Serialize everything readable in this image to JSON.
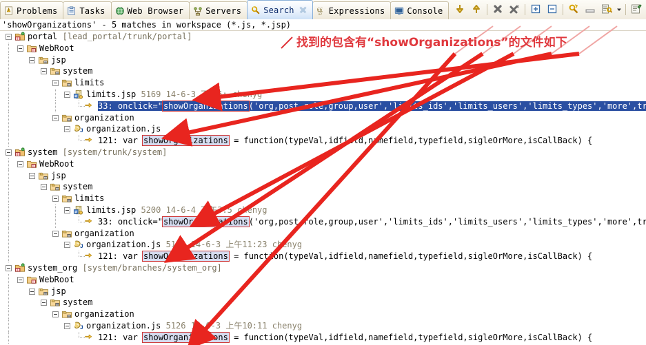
{
  "window": {
    "tabs": [
      {
        "label": "Problems",
        "icon": "problems-icon",
        "active": false,
        "closable": false
      },
      {
        "label": "Tasks",
        "icon": "tasks-icon",
        "active": false,
        "closable": false
      },
      {
        "label": "Web Browser",
        "icon": "web-browser-icon",
        "active": false,
        "closable": false
      },
      {
        "label": "Servers",
        "icon": "servers-icon",
        "active": false,
        "closable": false
      },
      {
        "label": "Search",
        "icon": "search-icon",
        "active": true,
        "closable": true
      },
      {
        "label": "Expressions",
        "icon": "expressions-icon",
        "active": false,
        "closable": false
      },
      {
        "label": "Console",
        "icon": "console-icon",
        "active": false,
        "closable": false
      }
    ],
    "toolbar": [
      {
        "name": "show-next-match-button",
        "glyph": "arrow-down-icon"
      },
      {
        "name": "show-previous-match-button",
        "glyph": "arrow-up-icon"
      },
      {
        "name": "remove-selected-matches-button",
        "glyph": "remove-match-icon"
      },
      {
        "name": "remove-all-matches-button",
        "glyph": "remove-all-matches-icon"
      },
      {
        "name": "expand-all-button",
        "glyph": "expand-all-icon"
      },
      {
        "name": "collapse-all-button",
        "glyph": "collapse-all-icon"
      },
      {
        "name": "run-current-search-again-button",
        "glyph": "refresh-search-icon"
      },
      {
        "name": "cancel-current-search-button",
        "glyph": "cancel-search-icon"
      },
      {
        "name": "previous-search-dropdown",
        "glyph": "search-history-icon"
      },
      {
        "name": "pin-search-view-button",
        "glyph": "pin-icon"
      }
    ]
  },
  "search_summary": "'showOrganizations' - 5 matches in workspace (*.js, *.jsp)",
  "annotation": {
    "text": "找到的包含有“showOrganizations”的文件如下",
    "color": "#e0393e",
    "arrow_count": 5
  },
  "highlight_term": "showOrganizations",
  "results": [
    {
      "project": "portal",
      "project_path": "[lead_portal/trunk/portal]",
      "icon": "java-project-icon",
      "children": [
        {
          "name": "WebRoot",
          "icon": "source-folder-icon",
          "children": [
            {
              "name": "jsp",
              "icon": "folder-icon",
              "children": [
                {
                  "name": "system",
                  "icon": "folder-icon",
                  "children": [
                    {
                      "name": "limits",
                      "icon": "folder-icon",
                      "children": [
                        {
                          "name": "limits.jsp",
                          "icon": "jsp-file-icon",
                          "revision": "5169",
                          "date": "14-6-3",
                          "time": "下午6:",
                          "author": "chenyg",
                          "matches": [
                            {
                              "line": "33:",
                              "selected": true,
                              "before": " onclick=\"",
                              "term": "showOrganizations",
                              "after": "('org,post,role,group,user','limits_ids','limits_users','limits_types','more',true);\">选择</a><a"
                            }
                          ]
                        }
                      ]
                    },
                    {
                      "name": "organization",
                      "icon": "folder-icon",
                      "children": [
                        {
                          "name": "organization.js",
                          "icon": "js-file-icon",
                          "revision": "",
                          "date": "",
                          "time": "",
                          "author": "",
                          "matches": [
                            {
                              "line": "121:",
                              "selected": false,
                              "before": " var ",
                              "term": "showOrganizations",
                              "after": " = function(typeVal,idfield,namefield,typefield,sigleOrMore,isCallBack) {"
                            }
                          ]
                        }
                      ]
                    }
                  ]
                }
              ]
            }
          ]
        }
      ]
    },
    {
      "project": "system",
      "project_path": "[system/trunk/system]",
      "icon": "java-project-icon",
      "children": [
        {
          "name": "WebRoot",
          "icon": "source-folder-icon",
          "children": [
            {
              "name": "jsp",
              "icon": "folder-icon",
              "children": [
                {
                  "name": "system",
                  "icon": "folder-icon",
                  "children": [
                    {
                      "name": "limits",
                      "icon": "folder-icon",
                      "children": [
                        {
                          "name": "limits.jsp",
                          "icon": "jsp-file-icon",
                          "revision": "5200",
                          "date": "14-6-4",
                          "time": "下午3:5",
                          "author": "chenyg",
                          "matches": [
                            {
                              "line": "33:",
                              "selected": false,
                              "before": " onclick=\"",
                              "term": "showOrganizations",
                              "after": "('org,post,role,group,user','limits_ids','limits_users','limits_types','more',true);\">选择</a><a"
                            }
                          ]
                        }
                      ]
                    },
                    {
                      "name": "organization",
                      "icon": "folder-icon",
                      "children": [
                        {
                          "name": "organization.js",
                          "icon": "js-file-icon",
                          "revision": "5141",
                          "date": "14-6-3",
                          "time": "上午11:23",
                          "author": "chenyg",
                          "matches": [
                            {
                              "line": "121:",
                              "selected": false,
                              "before": " var ",
                              "term": "showOrganizations",
                              "after": " = function(typeVal,idfield,namefield,typefield,sigleOrMore,isCallBack) {"
                            }
                          ]
                        }
                      ]
                    }
                  ]
                }
              ]
            }
          ]
        }
      ]
    },
    {
      "project": "system_org",
      "project_path": "[system/branches/system_org]",
      "icon": "java-project-icon",
      "children": [
        {
          "name": "WebRoot",
          "icon": "source-folder-icon",
          "children": [
            {
              "name": "jsp",
              "icon": "folder-icon",
              "children": [
                {
                  "name": "system",
                  "icon": "folder-icon",
                  "children": [
                    {
                      "name": "organization",
                      "icon": "folder-icon",
                      "children": [
                        {
                          "name": "organization.js",
                          "icon": "js-file-icon",
                          "revision": "5126",
                          "date": "14-6-3",
                          "time": "上午10:11",
                          "author": "chenyg",
                          "matches": [
                            {
                              "line": "121:",
                              "selected": false,
                              "before": " var ",
                              "term": "showOrganizations",
                              "after": " = function(typeVal,idfield,namefield,typefield,sigleOrMore,isCallBack) {"
                            }
                          ]
                        }
                      ]
                    }
                  ]
                }
              ]
            }
          ]
        }
      ]
    }
  ]
}
